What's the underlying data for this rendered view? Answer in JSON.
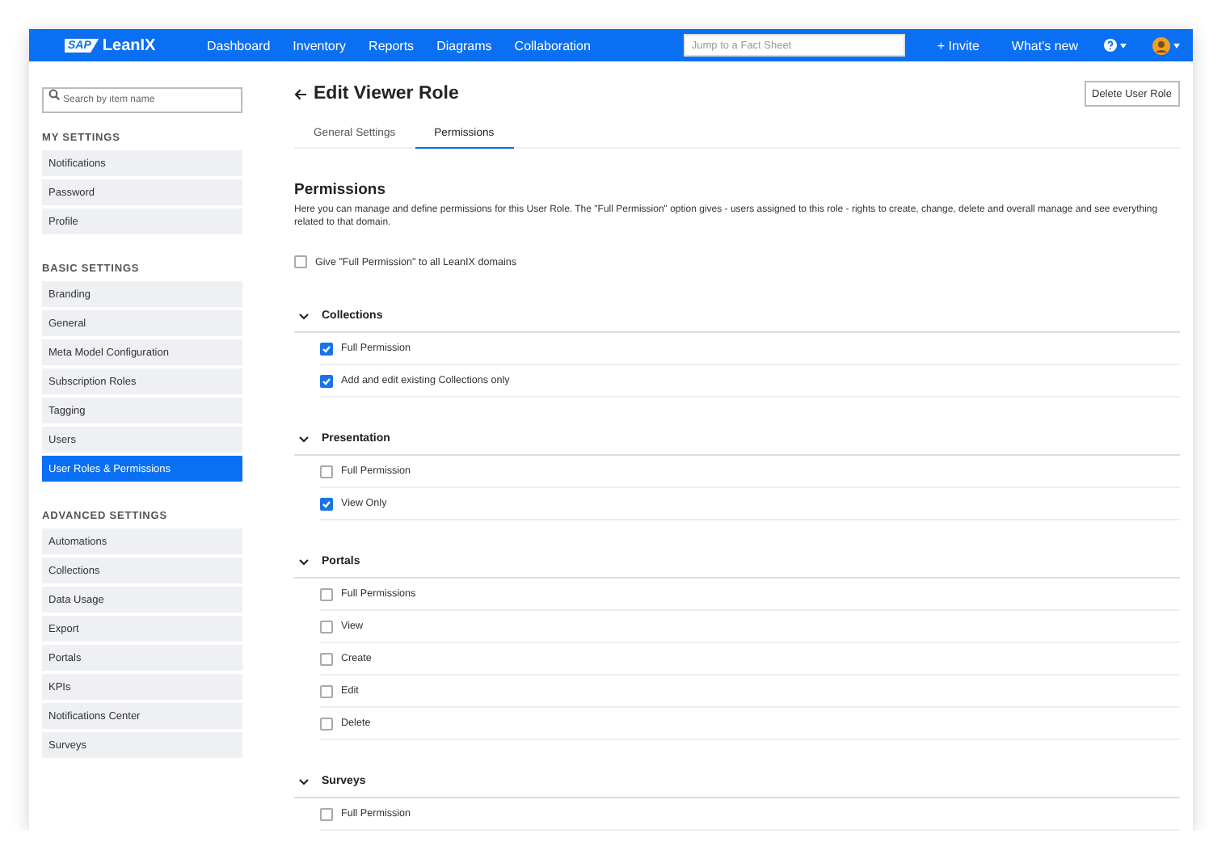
{
  "topbar": {
    "logo_badge": "SAP",
    "logo_text": "LeanIX",
    "nav": [
      "Dashboard",
      "Inventory",
      "Reports",
      "Diagrams",
      "Collaboration"
    ],
    "search": {
      "placeholder": "Jump to a Fact Sheet"
    },
    "invite": "+ Invite",
    "whats_new": "What's new"
  },
  "sidebar": {
    "search": {
      "placeholder": "Search by item name"
    },
    "groups": [
      {
        "title": "MY SETTINGS",
        "items": [
          {
            "label": "Notifications",
            "selected": false
          },
          {
            "label": "Password",
            "selected": false
          },
          {
            "label": "Profile",
            "selected": false
          }
        ]
      },
      {
        "title": "BASIC SETTINGS",
        "items": [
          {
            "label": "Branding",
            "selected": false
          },
          {
            "label": "General",
            "selected": false
          },
          {
            "label": "Meta Model Configuration",
            "selected": false
          },
          {
            "label": "Subscription Roles",
            "selected": false
          },
          {
            "label": "Tagging",
            "selected": false
          },
          {
            "label": "Users",
            "selected": false
          },
          {
            "label": "User Roles & Permissions",
            "selected": true
          }
        ]
      },
      {
        "title": "ADVANCED SETTINGS",
        "items": [
          {
            "label": "Automations",
            "selected": false
          },
          {
            "label": "Collections",
            "selected": false
          },
          {
            "label": "Data Usage",
            "selected": false
          },
          {
            "label": "Export",
            "selected": false
          },
          {
            "label": "Portals",
            "selected": false
          },
          {
            "label": "KPIs",
            "selected": false
          },
          {
            "label": "Notifications Center",
            "selected": false
          },
          {
            "label": "Surveys",
            "selected": false
          }
        ]
      }
    ]
  },
  "page": {
    "title": "Edit Viewer Role",
    "delete_button": "Delete User Role",
    "tabs": [
      {
        "label": "General Settings",
        "selected": false
      },
      {
        "label": "Permissions",
        "selected": true
      }
    ],
    "section_title": "Permissions",
    "description": "Here you can manage and define permissions for this User Role. The \"Full Permission\" option gives - users assigned to this role - rights to create, change, delete and overall manage and see everything related to that domain.",
    "global_option": {
      "label": "Give \"Full Permission\" to all LeanIX domains",
      "checked": false
    },
    "domains": [
      {
        "name": "Collections",
        "expanded": true,
        "permissions": [
          {
            "label": "Full Permission",
            "checked": true
          },
          {
            "label": "Add and edit existing Collections only",
            "checked": true
          }
        ]
      },
      {
        "name": "Presentation",
        "expanded": true,
        "permissions": [
          {
            "label": "Full Permission",
            "checked": false
          },
          {
            "label": "View Only",
            "checked": true
          }
        ]
      },
      {
        "name": "Portals",
        "expanded": true,
        "permissions": [
          {
            "label": "Full Permissions",
            "checked": false
          },
          {
            "label": "View",
            "checked": false
          },
          {
            "label": "Create",
            "checked": false
          },
          {
            "label": "Edit",
            "checked": false
          },
          {
            "label": "Delete",
            "checked": false
          }
        ]
      },
      {
        "name": "Surveys",
        "expanded": true,
        "permissions": [
          {
            "label": "Full Permission",
            "checked": false
          }
        ]
      }
    ]
  }
}
